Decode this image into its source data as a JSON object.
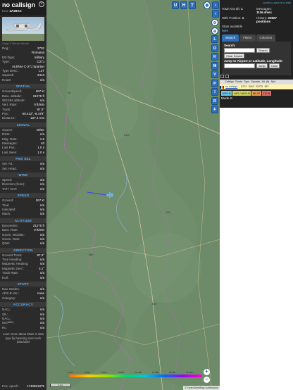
{
  "aircraft": {
    "callsign": "no callsign",
    "hex_label": "Hex:",
    "hex": "4A39AC",
    "photo_credit": "Image © Werner Wessel",
    "type_full": "ALENIA C-27J Spartan"
  },
  "info_rows": [
    {
      "k": "Reg.:",
      "v": "2702"
    },
    {
      "k": "",
      "v": "Romania"
    },
    {
      "k": "DB flags:",
      "v": "military"
    },
    {
      "k": "Type:",
      "v": "C27J"
    }
  ],
  "info_rows2": [
    {
      "k": "Type Desc.:",
      "v": "L2T"
    },
    {
      "k": "Squawk:",
      "v": "3443"
    },
    {
      "k": "Route:",
      "v": "n/a"
    }
  ],
  "sections": [
    {
      "title": "SPATIAL",
      "rows": [
        {
          "k": "Groundspeed:",
          "v": "267 kt"
        },
        {
          "k": "Baro. altitude:",
          "v": "21275 ft"
        },
        {
          "k": "WGS84 altitude:",
          "v": "n/a"
        },
        {
          "k": "Vert. Rate:",
          "v": "0 ft/min"
        },
        {
          "k": "Track:",
          "v": "97.0°"
        },
        {
          "k": "Pos.:",
          "v": "50.412°,-6.478°"
        },
        {
          "k": "Distance:",
          "v": "167.4 nmi"
        }
      ]
    },
    {
      "title": "SIGNAL",
      "rows": [
        {
          "k": "Source:",
          "v": "Other"
        },
        {
          "k": "RSSI:",
          "v": "n/a"
        },
        {
          "k": "Msg. Rate:",
          "v": "1.5"
        },
        {
          "k": "Messages:",
          "v": "40"
        },
        {
          "k": "Last Pos.:",
          "v": "1.0 s"
        },
        {
          "k": "Last Seen:",
          "v": "1.0 s"
        }
      ]
    },
    {
      "title": "FMS SEL",
      "rows": [
        {
          "k": "Sel. Alt.:",
          "v": "n/a"
        },
        {
          "k": "Sel. Head.:",
          "v": "n/a"
        }
      ]
    },
    {
      "title": "WIND",
      "rows": [
        {
          "k": "Speed:",
          "v": "n/a"
        },
        {
          "k": "Direction (from):",
          "v": "n/a"
        },
        {
          "k": "TAT / OAT:",
          "v": "n/a"
        }
      ]
    },
    {
      "title": "SPEED",
      "rows": [
        {
          "k": "Ground:",
          "v": "267 kt"
        },
        {
          "k": "True:",
          "v": "n/a"
        },
        {
          "k": "Indicated:",
          "v": "n/a"
        },
        {
          "k": "Mach:",
          "v": "n/a"
        }
      ]
    },
    {
      "title": "ALTITUDE",
      "rows": [
        {
          "k": "Barometric:",
          "v": "21275 ft"
        },
        {
          "k": "Baro. Rate:",
          "v": "0 ft/min"
        },
        {
          "k": "Geom. WGS84:",
          "v": "n/a"
        },
        {
          "k": "Geom. Rate:",
          "v": "n/a"
        },
        {
          "k": "QNH:",
          "v": "n/a"
        }
      ]
    },
    {
      "title": "DIRECTION",
      "rows": [
        {
          "k": "Ground Track:",
          "v": "97.0°"
        },
        {
          "k": "True Heading:",
          "v": "n/a"
        },
        {
          "k": "Magnetic Heading:",
          "v": "n/a"
        },
        {
          "k": "Magnetic Decl.:",
          "v": "3.1°"
        },
        {
          "k": "Track Rate:",
          "v": "n/a"
        },
        {
          "k": "Roll:",
          "v": "n/a"
        }
      ]
    },
    {
      "title": "STUFF",
      "rows": [
        {
          "k": "Nav. Modes:",
          "v": "n/a"
        },
        {
          "k": "ADS-B Ver.:",
          "v": "none"
        },
        {
          "k": "Category:",
          "v": "n/a"
        }
      ]
    },
    {
      "title": "ACCURACY",
      "rows": [
        {
          "k": "NACₚ:",
          "v": "n/a"
        },
        {
          "k": "SIL:",
          "v": "n/a"
        },
        {
          "k": "NACᵥ:",
          "v": "n/a"
        },
        {
          "k": "NICᴮᴬᴿᴼ:",
          "v": "n/a"
        },
        {
          "k": "Rc:",
          "v": "n/a"
        }
      ]
    }
  ],
  "learn_more": "Learn more about Mode S data type by hovering over each data label",
  "pos_epoch": {
    "k": "Pos. epoch:",
    "v": "1740651875"
  },
  "map": {
    "top_buttons": [
      "U",
      "H",
      "T"
    ],
    "side_tools": [
      "L",
      "O",
      "K",
      "M",
      "V",
      "P",
      "I",
      "R",
      "F"
    ],
    "zoom_in": "+",
    "zoom_out": "−",
    "legend_ticks": [
      "2 000",
      "4 000",
      "6 000",
      "8 000",
      "10 000",
      "20 000",
      "30 000",
      "40 000+"
    ],
    "scale": "5 km",
    "osm_credit": "© OpenStreetMap contributors",
    "place_labels": [
      "N4",
      "E411",
      "N89",
      "E25",
      "N40"
    ]
  },
  "right": {
    "version": "tar1090 on github (3.14.1705)",
    "total_label": "Total Aircraft:",
    "total": "1",
    "messages_label": "Messages:",
    "messages": "1116.4/sec",
    "withpos_label": "With Position:",
    "withpos": "1",
    "history_label": "History:",
    "history": "23607 positions",
    "stats_label": "Stats available",
    "stats_link": "here",
    "tabs": [
      "Search",
      "Filters",
      "Columns"
    ],
    "search_label": "Search:",
    "search_btn": "Search",
    "clear_search_btn": "Clear Search",
    "jump_label": "Jump to Airport or Latitude, Longitude:",
    "jump_btn": "Jump",
    "clear_btn": "Clear",
    "table_headers": [
      "",
      "Callsign",
      "Route",
      "Type",
      "Squawk",
      "Alt. (ft)",
      "Spd"
    ],
    "table_row": [
      "",
      "no callsign",
      "",
      "C27J",
      "3443",
      "21275",
      "267"
    ],
    "sources": [
      {
        "label": "ADS-B",
        "color": "#6fc9e8"
      },
      {
        "label": "UAT / ADS-R",
        "color": "#d1d15a"
      },
      {
        "label": "MLAT",
        "color": "#e89a4a"
      },
      {
        "label": "TIS-B",
        "color": "#e06a6a"
      }
    ],
    "mode_s": "Mode-S"
  }
}
